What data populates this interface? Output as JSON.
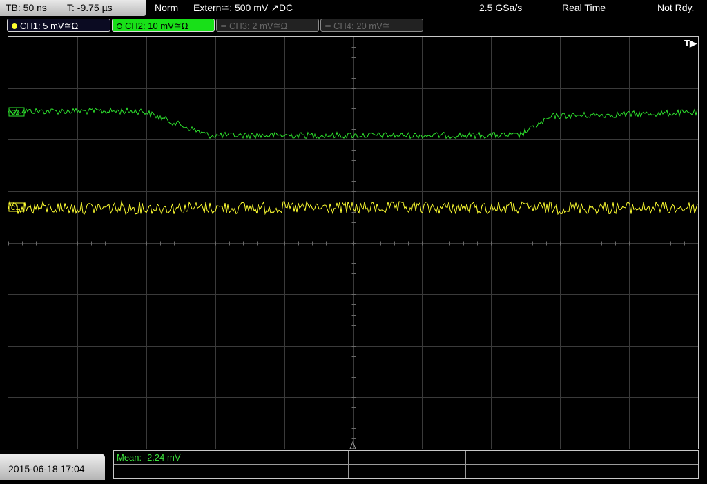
{
  "top": {
    "timebase": "TB: 50 ns",
    "trigger_offset": "T: -9.75 µs",
    "mode": "Norm",
    "trigger_source": "Extern≅: 500 mV ↗DC",
    "sample_rate": "2.5 GSa/s",
    "acquisition": "Real Time",
    "status": "Not Rdy."
  },
  "channels": [
    {
      "label": "CH1: 5 mV≅Ω",
      "color": "#ffff30",
      "active": true
    },
    {
      "label": "CH2: 10 mV≅Ω",
      "color": "#18e018",
      "active": true
    },
    {
      "label": "CH3: 2 mV≅Ω",
      "color": "#666666",
      "active": false
    },
    {
      "label": "CH4: 20 mV≅",
      "color": "#666666",
      "active": false
    }
  ],
  "trigger_marker": "T▶",
  "ch2_marker": "C2",
  "ch1_marker": "C1",
  "bottom": {
    "datetime": "2015-06-18 17:04",
    "measurement": "Mean: -2.24 mV"
  },
  "colors": {
    "ch1_trace": "#ffff30",
    "ch2_trace": "#2ee62e",
    "grid": "#3a3a3a"
  }
}
